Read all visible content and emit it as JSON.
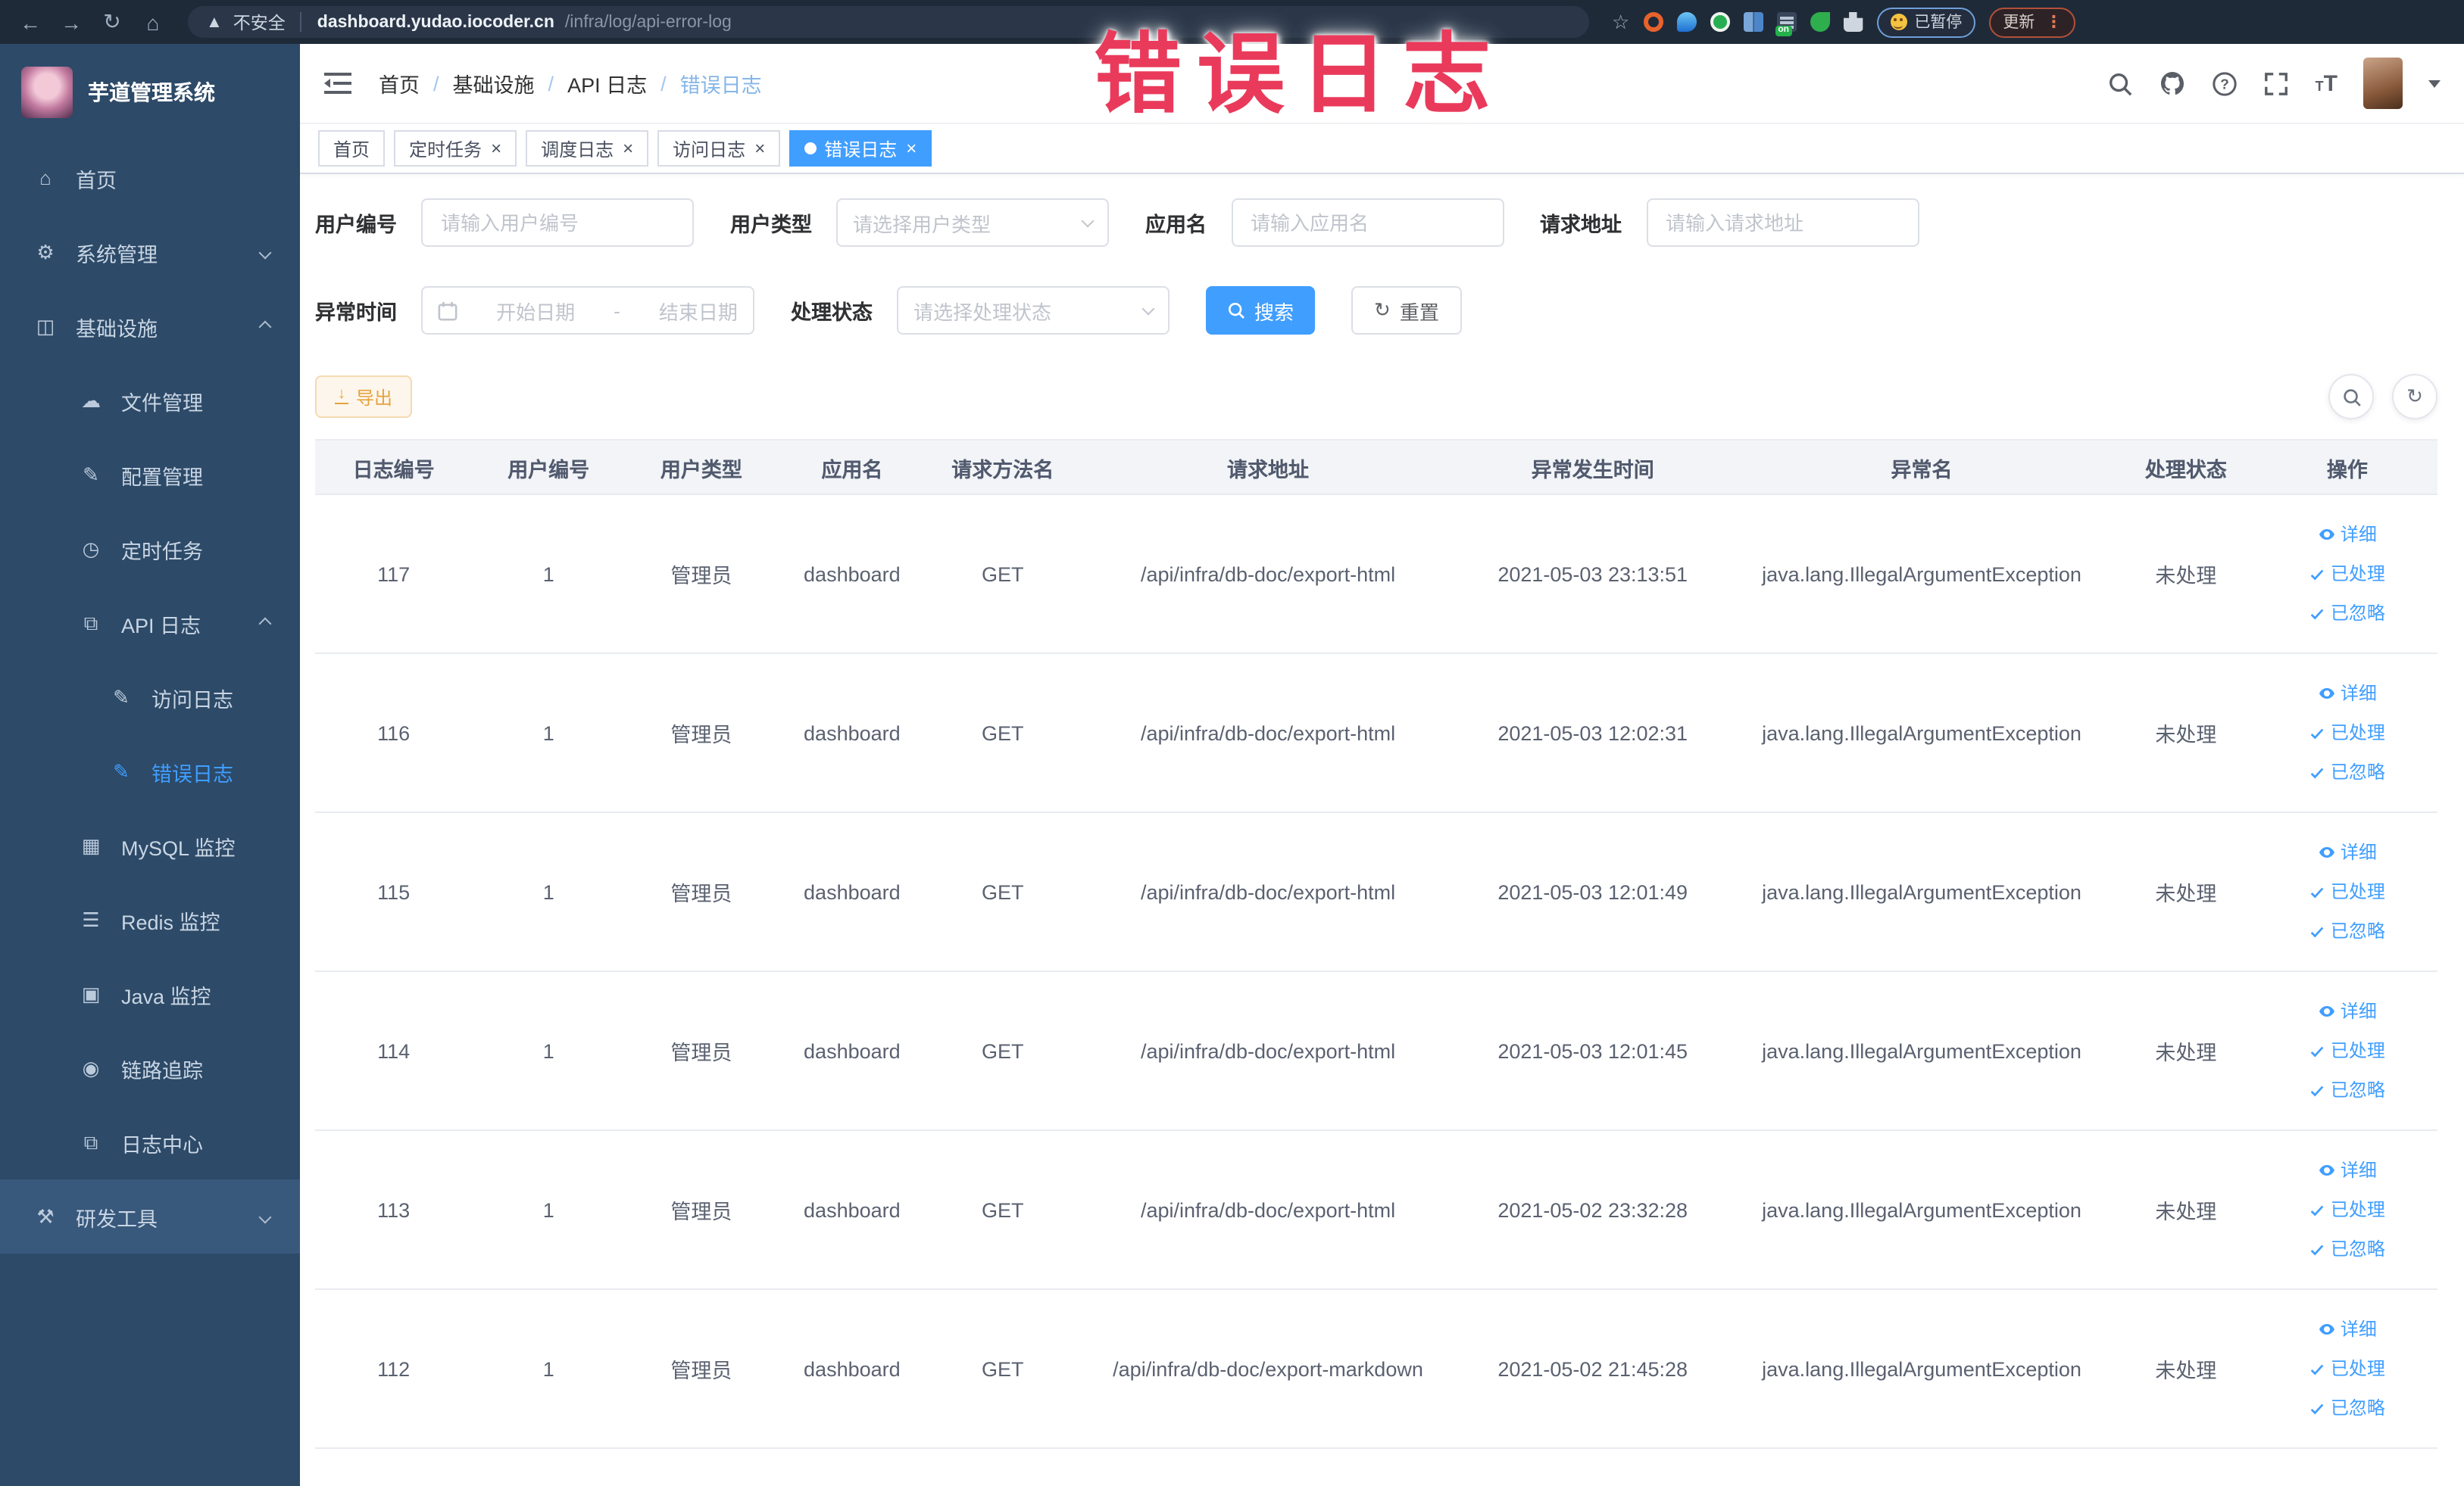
{
  "browser": {
    "security_label": "不安全",
    "url_host": "dashboard.yudao.iocoder.cn",
    "url_path": "/infra/log/api-error-log",
    "paused_label": "已暂停",
    "update_label": "更新"
  },
  "overlay": {
    "text": "错误日志"
  },
  "sidebar": {
    "title": "芋道管理系统",
    "items": [
      {
        "key": "home",
        "label": "首页",
        "icon": "home-icon",
        "level": 1
      },
      {
        "key": "system",
        "label": "系统管理",
        "icon": "gear-icon",
        "level": 1,
        "chevron": "down"
      },
      {
        "key": "infra",
        "label": "基础设施",
        "icon": "monitor-icon",
        "level": 1,
        "chevron": "up"
      },
      {
        "key": "file",
        "label": "文件管理",
        "icon": "cloud-upload-icon",
        "level": 2
      },
      {
        "key": "config",
        "label": "配置管理",
        "icon": "edit-icon",
        "level": 2
      },
      {
        "key": "cron",
        "label": "定时任务",
        "icon": "timer-icon",
        "level": 2
      },
      {
        "key": "api-log",
        "label": "API 日志",
        "icon": "log-icon",
        "level": 2,
        "chevron": "up"
      },
      {
        "key": "access-log",
        "label": "访问日志",
        "icon": "edit-square-icon",
        "level": 3
      },
      {
        "key": "error-log",
        "label": "错误日志",
        "icon": "edit-square-icon",
        "level": 3,
        "active": true
      },
      {
        "key": "mysql",
        "label": "MySQL 监控",
        "icon": "database-icon",
        "level": 2
      },
      {
        "key": "redis",
        "label": "Redis 监控",
        "icon": "stack-icon",
        "level": 2
      },
      {
        "key": "java",
        "label": "Java 监控",
        "icon": "screen-icon",
        "level": 2
      },
      {
        "key": "trace",
        "label": "链路追踪",
        "icon": "eye-icon",
        "level": 2
      },
      {
        "key": "log-center",
        "label": "日志中心",
        "icon": "log-center-icon",
        "level": 2
      },
      {
        "key": "devtools",
        "label": "研发工具",
        "icon": "toolbox-icon",
        "level": 1,
        "chevron": "down",
        "highlighted": true
      }
    ]
  },
  "header": {
    "breadcrumb": [
      "首页",
      "基础设施",
      "API 日志",
      "错误日志"
    ]
  },
  "tabs": [
    {
      "key": "home",
      "label": "首页",
      "closable": false,
      "active": false
    },
    {
      "key": "cron-job",
      "label": "定时任务",
      "closable": true,
      "active": false
    },
    {
      "key": "schedule-log",
      "label": "调度日志",
      "closable": true,
      "active": false
    },
    {
      "key": "access-log",
      "label": "访问日志",
      "closable": true,
      "active": false
    },
    {
      "key": "error-log",
      "label": "错误日志",
      "closable": true,
      "active": true
    }
  ],
  "filters": {
    "user_id": {
      "label": "用户编号",
      "placeholder": "请输入用户编号"
    },
    "user_type": {
      "label": "用户类型",
      "placeholder": "请选择用户类型"
    },
    "app_name": {
      "label": "应用名",
      "placeholder": "请输入应用名"
    },
    "request_url": {
      "label": "请求地址",
      "placeholder": "请输入请求地址"
    },
    "exception_time": {
      "label": "异常时间",
      "start": "开始日期",
      "separator": "-",
      "end": "结束日期"
    },
    "process_status": {
      "label": "处理状态",
      "placeholder": "请选择处理状态"
    },
    "search_label": "搜索",
    "reset_label": "重置"
  },
  "toolbar": {
    "export_label": "导出"
  },
  "table": {
    "columns": [
      "日志编号",
      "用户编号",
      "用户类型",
      "应用名",
      "请求方法名",
      "请求地址",
      "异常发生时间",
      "异常名",
      "处理状态",
      "操作"
    ],
    "row_keys": [
      "id",
      "user_id",
      "user_type",
      "app",
      "method",
      "url",
      "time",
      "exception",
      "status"
    ],
    "row_actions": [
      {
        "label": "详细",
        "name": "detail-action-link",
        "icon": "eye-icon"
      },
      {
        "label": "已处理",
        "name": "processed-action-link",
        "icon": "check-icon"
      },
      {
        "label": "已忽略",
        "name": "ignored-action-link",
        "icon": "check-icon"
      }
    ],
    "rows": [
      {
        "id": "117",
        "user_id": "1",
        "user_type": "管理员",
        "app": "dashboard",
        "method": "GET",
        "url": "/api/infra/db-doc/export-html",
        "time": "2021-05-03 23:13:51",
        "exception": "java.lang.IllegalArgumentException",
        "status": "未处理"
      },
      {
        "id": "116",
        "user_id": "1",
        "user_type": "管理员",
        "app": "dashboard",
        "method": "GET",
        "url": "/api/infra/db-doc/export-html",
        "time": "2021-05-03 12:02:31",
        "exception": "java.lang.IllegalArgumentException",
        "status": "未处理"
      },
      {
        "id": "115",
        "user_id": "1",
        "user_type": "管理员",
        "app": "dashboard",
        "method": "GET",
        "url": "/api/infra/db-doc/export-html",
        "time": "2021-05-03 12:01:49",
        "exception": "java.lang.IllegalArgumentException",
        "status": "未处理"
      },
      {
        "id": "114",
        "user_id": "1",
        "user_type": "管理员",
        "app": "dashboard",
        "method": "GET",
        "url": "/api/infra/db-doc/export-html",
        "time": "2021-05-03 12:01:45",
        "exception": "java.lang.IllegalArgumentException",
        "status": "未处理"
      },
      {
        "id": "113",
        "user_id": "1",
        "user_type": "管理员",
        "app": "dashboard",
        "method": "GET",
        "url": "/api/infra/db-doc/export-html",
        "time": "2021-05-02 23:32:28",
        "exception": "java.lang.IllegalArgumentException",
        "status": "未处理"
      },
      {
        "id": "112",
        "user_id": "1",
        "user_type": "管理员",
        "app": "dashboard",
        "method": "GET",
        "url": "/api/infra/db-doc/export-markdown",
        "time": "2021-05-02 21:45:28",
        "exception": "java.lang.IllegalArgumentException",
        "status": "未处理"
      }
    ]
  }
}
